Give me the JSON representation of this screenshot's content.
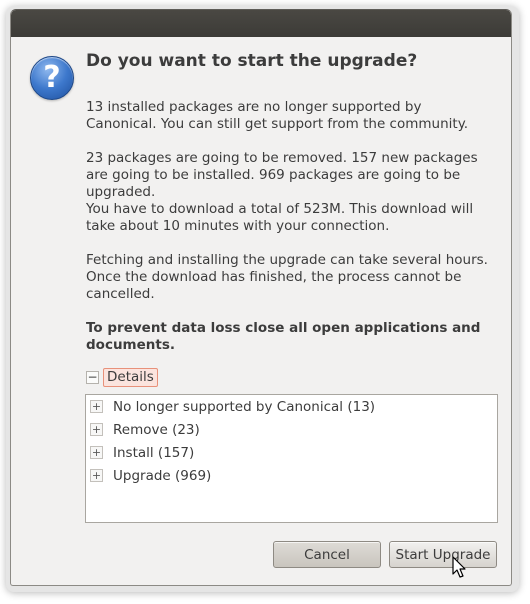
{
  "dialog": {
    "icon": "question-icon",
    "icon_glyph": "?",
    "title": "Do you want to start the upgrade?",
    "paragraphs": [
      "13 installed packages are no longer supported by Canonical. You can still get support from the community.",
      "23 packages are going to be removed. 157 new packages are going to be installed. 969 packages are going to be upgraded.",
      "You have to download a total of 523M. This download will take about 10 minutes with your connection.",
      "Fetching and installing the upgrade can take several hours. Once the download has finished, the process cannot be cancelled."
    ],
    "warning": "To prevent data loss close all open applications and documents."
  },
  "details": {
    "toggle_glyph": "−",
    "label": "Details",
    "items": [
      {
        "expander": "+",
        "label": "No longer supported by Canonical (13)"
      },
      {
        "expander": "+",
        "label": "Remove (23)"
      },
      {
        "expander": "+",
        "label": "Install (157)"
      },
      {
        "expander": "+",
        "label": "Upgrade (969)"
      }
    ]
  },
  "buttons": {
    "cancel": "Cancel",
    "start": "Start Upgrade"
  },
  "colors": {
    "dialog_bg": "#f2f1f0",
    "title_bar": "#3c3b37",
    "icon_blue": "#3d78cc",
    "expander_highlight": "#e8917a"
  }
}
